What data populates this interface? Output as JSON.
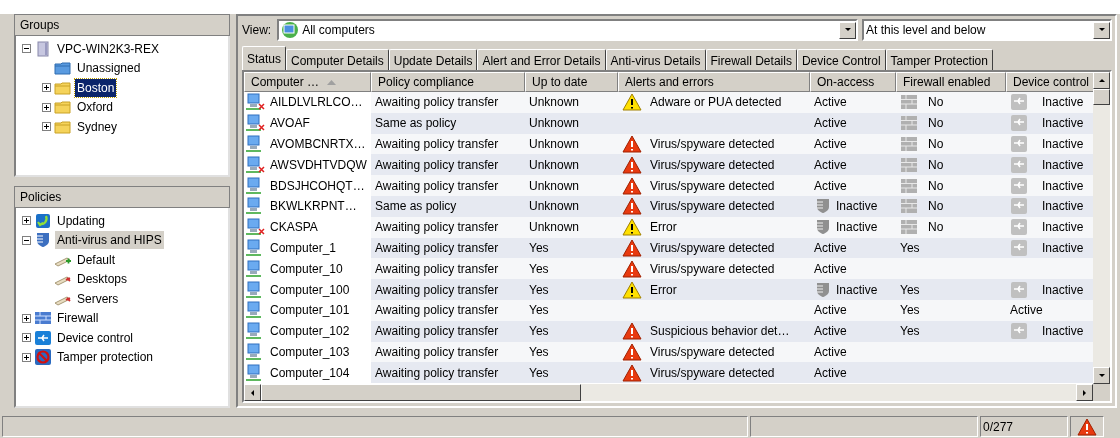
{
  "groups": {
    "title": "Groups",
    "tree": [
      {
        "label": "VPC-WIN2K3-REX",
        "kind": "server",
        "expanded": true,
        "selected": false,
        "children": [
          {
            "label": "Unassigned",
            "kind": "special-folder",
            "selected": false
          },
          {
            "label": "Boston",
            "kind": "folder",
            "expanded": false,
            "selected": true
          },
          {
            "label": "Oxford",
            "kind": "folder",
            "expanded": false,
            "selected": false
          },
          {
            "label": "Sydney",
            "kind": "folder",
            "expanded": false,
            "selected": false
          }
        ]
      }
    ]
  },
  "policies": {
    "title": "Policies",
    "tree": [
      {
        "label": "Updating",
        "kind": "updating",
        "expanded": false,
        "selected": false
      },
      {
        "label": "Anti-virus and HIPS",
        "kind": "antivirus",
        "expanded": true,
        "selected": true,
        "children": [
          {
            "label": "Default",
            "kind": "default-policy",
            "selected": false
          },
          {
            "label": "Desktops",
            "kind": "policy",
            "selected": false
          },
          {
            "label": "Servers",
            "kind": "policy",
            "selected": false
          }
        ]
      },
      {
        "label": "Firewall",
        "kind": "firewall",
        "expanded": false,
        "selected": false
      },
      {
        "label": "Device control",
        "kind": "device",
        "expanded": false,
        "selected": false
      },
      {
        "label": "Tamper protection",
        "kind": "tamper",
        "expanded": false,
        "selected": false
      }
    ]
  },
  "view": {
    "label": "View:",
    "value": "All computers",
    "scope": "At this level and below"
  },
  "tabs": [
    {
      "label": "Status",
      "selected": true
    },
    {
      "label": "Computer Details",
      "selected": false
    },
    {
      "label": "Update Details",
      "selected": false
    },
    {
      "label": "Alert and Error Details",
      "selected": false
    },
    {
      "label": "Anti-virus Details",
      "selected": false
    },
    {
      "label": "Firewall Details",
      "selected": false
    },
    {
      "label": "Device Control",
      "selected": false
    },
    {
      "label": "Tamper Protection",
      "selected": false
    }
  ],
  "table": {
    "columns": [
      {
        "label": "Computer …",
        "sorted": true
      },
      {
        "label": "Policy compliance",
        "sorted": false
      },
      {
        "label": "Up to date",
        "sorted": false
      },
      {
        "label": "Alerts and errors",
        "sorted": false
      },
      {
        "label": "On-access",
        "sorted": false
      },
      {
        "label": "Firewall enabled",
        "sorted": false
      },
      {
        "label": "Device control",
        "sorted": false
      }
    ],
    "rows": [
      {
        "computer": "AILDLVLRLCO…",
        "disconnected": true,
        "policy": "Awaiting policy transfer",
        "up_to_date": "Unknown",
        "alert_critical": false,
        "alert": "Adware or PUA detected",
        "on_access": "Active",
        "on_access_icon": false,
        "firewall": "No",
        "firewall_icon": true,
        "device_control": "Inactive",
        "device_icon": true
      },
      {
        "computer": "AVOAF",
        "disconnected": true,
        "policy": "Same as policy",
        "up_to_date": "Unknown",
        "on_access": "Active",
        "on_access_icon": false,
        "firewall": "No",
        "firewall_icon": true,
        "device_control": "Inactive",
        "device_icon": true
      },
      {
        "computer": "AVOMBCNRTX…",
        "disconnected": false,
        "policy": "Awaiting policy transfer",
        "up_to_date": "Unknown",
        "alert_critical": true,
        "alert": "Virus/spyware detected",
        "on_access": "Active",
        "on_access_icon": false,
        "firewall": "No",
        "firewall_icon": true,
        "device_control": "Inactive",
        "device_icon": true
      },
      {
        "computer": "AWSVDHTVDQW",
        "disconnected": true,
        "policy": "Awaiting policy transfer",
        "up_to_date": "Unknown",
        "alert_critical": true,
        "alert": "Virus/spyware detected",
        "on_access": "Active",
        "on_access_icon": false,
        "firewall": "No",
        "firewall_icon": true,
        "device_control": "Inactive",
        "device_icon": true
      },
      {
        "computer": "BDSJHCOHQT…",
        "disconnected": false,
        "policy": "Awaiting policy transfer",
        "up_to_date": "Unknown",
        "alert_critical": true,
        "alert": "Virus/spyware detected",
        "on_access": "Active",
        "on_access_icon": false,
        "firewall": "No",
        "firewall_icon": true,
        "device_control": "Inactive",
        "device_icon": true
      },
      {
        "computer": "BKWLKRPNT…",
        "disconnected": false,
        "policy": "Same as policy",
        "up_to_date": "Unknown",
        "alert_critical": true,
        "alert": "Virus/spyware detected",
        "on_access": "Inactive",
        "on_access_icon": true,
        "firewall": "No",
        "firewall_icon": true,
        "device_control": "Inactive",
        "device_icon": true
      },
      {
        "computer": "CKASPA",
        "disconnected": true,
        "policy": "Awaiting policy transfer",
        "up_to_date": "Unknown",
        "alert_critical": false,
        "alert": "Error",
        "on_access": "Inactive",
        "on_access_icon": true,
        "firewall": "No",
        "firewall_icon": true,
        "device_control": "Inactive",
        "device_icon": true
      },
      {
        "computer": "Computer_1",
        "disconnected": false,
        "policy": "Awaiting policy transfer",
        "up_to_date": "Yes",
        "alert_critical": true,
        "alert": "Virus/spyware detected",
        "on_access": "Active",
        "on_access_icon": false,
        "firewall": "Yes",
        "firewall_icon": false,
        "device_control": "Inactive",
        "device_icon": true
      },
      {
        "computer": "Computer_10",
        "disconnected": false,
        "policy": "Awaiting policy transfer",
        "up_to_date": "Yes",
        "alert_critical": true,
        "alert": "Virus/spyware detected",
        "on_access": "Active",
        "on_access_icon": false,
        "firewall_icon": false,
        "device_icon": false
      },
      {
        "computer": "Computer_100",
        "disconnected": false,
        "policy": "Awaiting policy transfer",
        "up_to_date": "Yes",
        "alert_critical": false,
        "alert": "Error",
        "on_access": "Inactive",
        "on_access_icon": true,
        "firewall": "Yes",
        "firewall_icon": false,
        "device_control": "Inactive",
        "device_icon": true
      },
      {
        "computer": "Computer_101",
        "disconnected": false,
        "policy": "Awaiting policy transfer",
        "up_to_date": "Yes",
        "on_access": "Active",
        "on_access_icon": false,
        "firewall": "Yes",
        "firewall_icon": false,
        "device_control": "Active",
        "device_icon": false
      },
      {
        "computer": "Computer_102",
        "disconnected": false,
        "policy": "Awaiting policy transfer",
        "up_to_date": "Yes",
        "alert_critical": true,
        "alert": "Suspicious behavior det…",
        "on_access": "Active",
        "on_access_icon": false,
        "firewall": "Yes",
        "firewall_icon": false,
        "device_control": "Inactive",
        "device_icon": true
      },
      {
        "computer": "Computer_103",
        "disconnected": false,
        "policy": "Awaiting policy transfer",
        "up_to_date": "Yes",
        "alert_critical": true,
        "alert": "Virus/spyware detected",
        "on_access": "Active",
        "on_access_icon": false,
        "firewall_icon": false,
        "device_icon": false
      },
      {
        "computer": "Computer_104",
        "disconnected": false,
        "policy": "Awaiting policy transfer",
        "up_to_date": "Yes",
        "alert_critical": true,
        "alert": "Virus/spyware detected",
        "on_access": "Active",
        "on_access_icon": false,
        "firewall_icon": false,
        "device_icon": false
      }
    ]
  },
  "status_bar": {
    "count": "0/277",
    "alert_critical": true
  }
}
